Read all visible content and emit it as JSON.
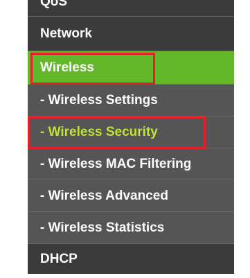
{
  "menu": {
    "top_partial_label": "QoS",
    "items": [
      {
        "label": "Network"
      },
      {
        "label": "Wireless"
      },
      {
        "label": "- Wireless Settings"
      },
      {
        "label": "- Wireless Security"
      },
      {
        "label": "- Wireless MAC Filtering"
      },
      {
        "label": "- Wireless Advanced"
      },
      {
        "label": "- Wireless Statistics"
      },
      {
        "label": "DHCP"
      }
    ]
  },
  "colors": {
    "menu_bg": "#3b3b3b",
    "submenu_bg": "#555555",
    "active_bg": "#63b82a",
    "current_text": "#bfe23a",
    "highlight_border": "#e0202a"
  }
}
